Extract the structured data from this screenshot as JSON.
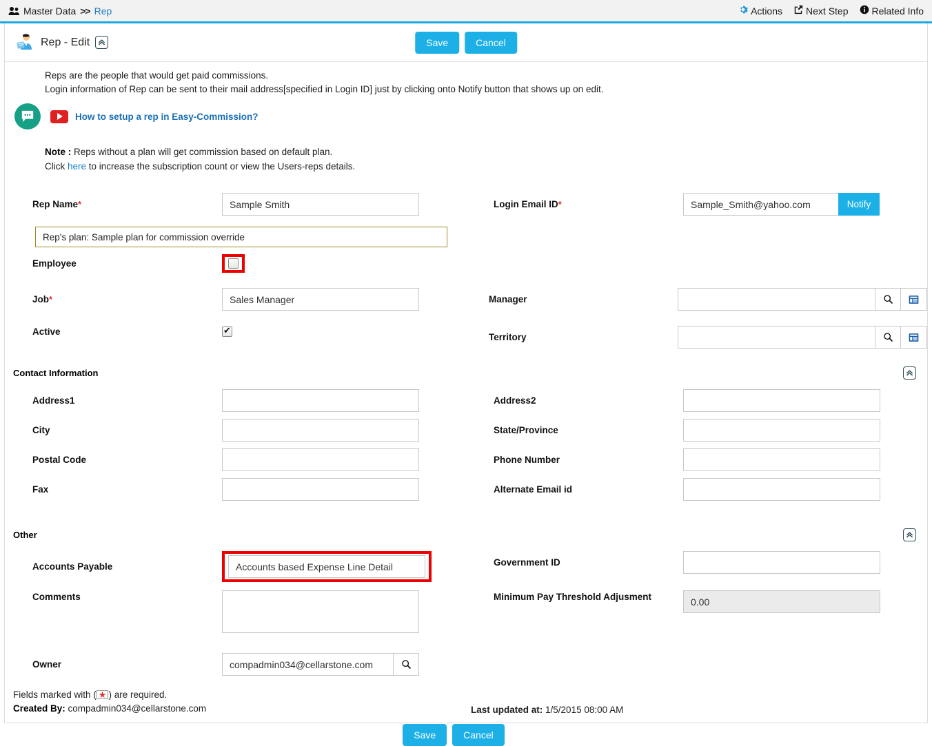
{
  "breadcrumb": {
    "icon": "users-icon",
    "root": "Master Data",
    "separator": ">>",
    "current": "Rep"
  },
  "header_actions": [
    {
      "icon": "gear-icon",
      "label": "Actions"
    },
    {
      "icon": "external-link-icon",
      "label": "Next Step"
    },
    {
      "icon": "info-icon",
      "label": "Related Info"
    }
  ],
  "titlebar": {
    "icon": "rep-avatar-icon",
    "title": "Rep - Edit",
    "collapse_icon": "double-chevron-up-icon",
    "save_label": "Save",
    "cancel_label": "Cancel"
  },
  "info": {
    "line1": "Reps are the people that would get paid commissions.",
    "line2": "Login information of Rep can be sent to their mail address[specified in Login ID] just by clicking onto Notify button that shows up on edit.",
    "chat_icon": "chat-bubble-icon",
    "video_icon": "youtube-play-icon",
    "video_link": "How to setup a rep in Easy-Commission?",
    "note_label": "Note :",
    "note_text": "Reps without a plan will get commission based on default plan.",
    "click_prefix": "Click ",
    "click_link": "here",
    "click_suffix": " to increase the subscription count or view the Users-reps details."
  },
  "form": {
    "rep_name": {
      "label": "Rep Name",
      "required": true,
      "value": "Sample Smith"
    },
    "login_email": {
      "label": "Login Email ID",
      "required": true,
      "value": "Sample_Smith@yahoo.com",
      "notify_label": "Notify"
    },
    "plan_banner": "Rep's plan: Sample plan for commission override",
    "employee": {
      "label": "Employee",
      "checked": false,
      "highlighted": true
    },
    "job": {
      "label": "Job",
      "required": true,
      "value": "Sales Manager"
    },
    "manager": {
      "label": "Manager",
      "value": "",
      "search_icon": "search-icon",
      "list_icon": "list-icon"
    },
    "active": {
      "label": "Active",
      "checked": true
    },
    "territory": {
      "label": "Territory",
      "value": "",
      "search_icon": "search-icon",
      "list_icon": "list-icon"
    }
  },
  "contact_section": {
    "title": "Contact Information",
    "collapse_icon": "double-chevron-up-icon",
    "fields": [
      {
        "label": "Address1",
        "value": ""
      },
      {
        "label": "Address2",
        "value": ""
      },
      {
        "label": "City",
        "value": ""
      },
      {
        "label": "State/Province",
        "value": ""
      },
      {
        "label": "Postal Code",
        "value": ""
      },
      {
        "label": "Phone Number",
        "value": ""
      },
      {
        "label": "Fax",
        "value": ""
      },
      {
        "label": "Alternate Email id",
        "value": ""
      }
    ]
  },
  "other_section": {
    "title": "Other",
    "collapse_icon": "double-chevron-up-icon",
    "accounts_payable": {
      "label": "Accounts Payable",
      "value": "Accounts based Expense Line Detail",
      "highlighted": true
    },
    "government_id": {
      "label": "Government ID",
      "value": ""
    },
    "comments": {
      "label": "Comments",
      "value": ""
    },
    "min_pay": {
      "label": "Minimum Pay Threshold Adjusment",
      "value": "0.00",
      "readonly": true
    },
    "owner": {
      "label": "Owner",
      "value": "compadmin034@cellarstone.com",
      "search_icon": "search-icon"
    }
  },
  "footer": {
    "required_prefix": "Fields marked with (",
    "required_star": "★",
    "required_suffix": ") are required.",
    "created_by_label": "Created By:",
    "created_by_value": "compadmin034@cellarstone.com",
    "updated_label": "Last updated at:",
    "updated_value": "1/5/2015 08:00 AM",
    "save_label": "Save",
    "cancel_label": "Cancel"
  },
  "colors": {
    "accent": "#1cb0e6",
    "link": "#1b7fc4",
    "required": "#e03131",
    "highlight": "#ee0000",
    "plan_border": "#9e8a29",
    "chat_green": "#16a085",
    "youtube_red": "#e02020"
  }
}
